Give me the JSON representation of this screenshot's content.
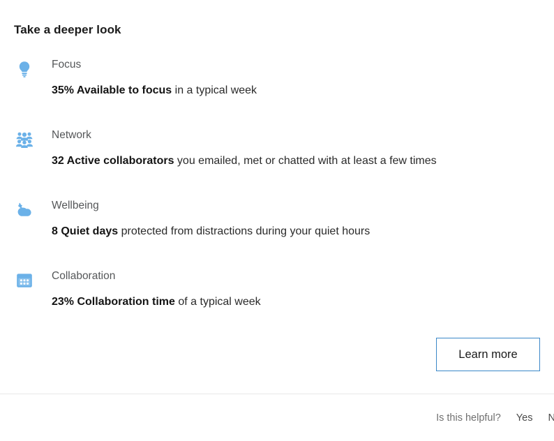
{
  "card": {
    "title": "Take a deeper look",
    "accent_blue": "#6BB1E8",
    "button_border_blue": "#3A87C8",
    "text_color": "#1F1F1F",
    "category_color": "#555759"
  },
  "insights": [
    {
      "icon": "lightbulb-icon",
      "category": "Focus",
      "value": "35%",
      "metric": "Available to focus",
      "strong_text": "35% Available to focus",
      "rest_text": " in a typical week"
    },
    {
      "icon": "people-group-icon",
      "category": "Network",
      "value": "32",
      "metric": "Active collaborators",
      "strong_text": "32 Active collaborators",
      "rest_text": " you emailed, met or chatted with at least a few times"
    },
    {
      "icon": "cloud-moon-icon",
      "category": "Wellbeing",
      "value": "8",
      "metric": "Quiet days",
      "strong_text": "8 Quiet days",
      "rest_text": " protected from distractions during your quiet hours"
    },
    {
      "icon": "calendar-icon",
      "category": "Collaboration",
      "value": "23%",
      "metric": "Collaboration time",
      "strong_text": "23% Collaboration time",
      "rest_text": " of a typical week"
    }
  ],
  "actions": {
    "learn_more_label": "Learn more"
  },
  "footer": {
    "helpful_label": "Is this helpful?",
    "yes_label": "Yes",
    "no_label": "No"
  }
}
